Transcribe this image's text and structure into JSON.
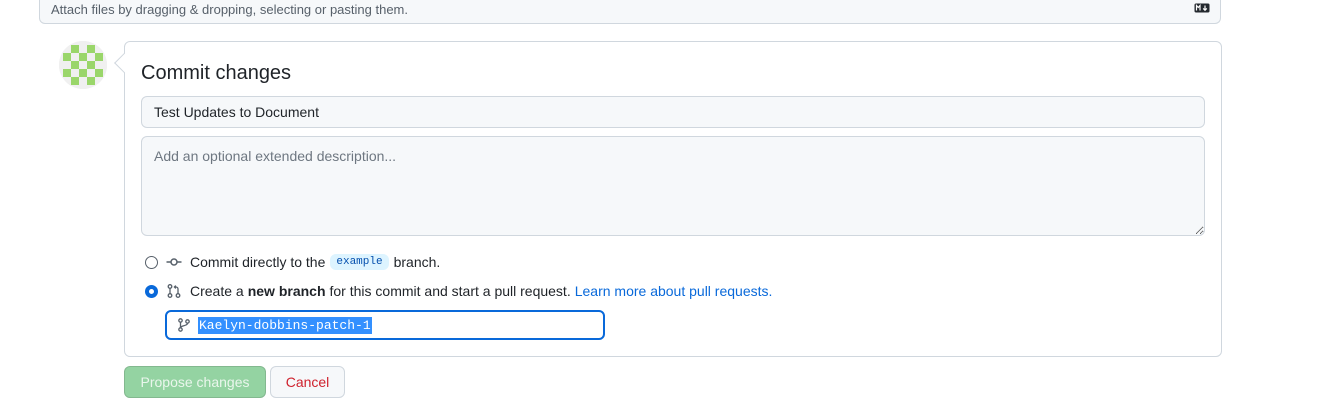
{
  "attach": {
    "text": "Attach files by dragging & dropping, selecting or pasting them.",
    "markdown_icon": "markdown-icon"
  },
  "avatar": {
    "icon": "identicon-avatar",
    "color": "#9ad66a"
  },
  "commit": {
    "title": "Commit changes",
    "summary_value": "Test Updates to Document",
    "description_placeholder": "Add an optional extended description...",
    "option_direct": {
      "prefix": "Commit directly to the",
      "branch": "example",
      "suffix": "branch.",
      "checked": false,
      "icon": "git-commit-icon"
    },
    "option_new_branch": {
      "prefix": "Create a",
      "bold": "new branch",
      "suffix": "for this commit and start a pull request.",
      "link": "Learn more about pull requests.",
      "checked": true,
      "icon": "git-pull-request-icon"
    },
    "branch_name": "Kaelyn-dobbins-patch-1",
    "branch_icon": "git-branch-icon"
  },
  "buttons": {
    "propose": "Propose changes",
    "cancel": "Cancel"
  },
  "colors": {
    "accent": "#0969da",
    "propose_disabled": "#94d3a2",
    "danger": "#cf222e"
  }
}
